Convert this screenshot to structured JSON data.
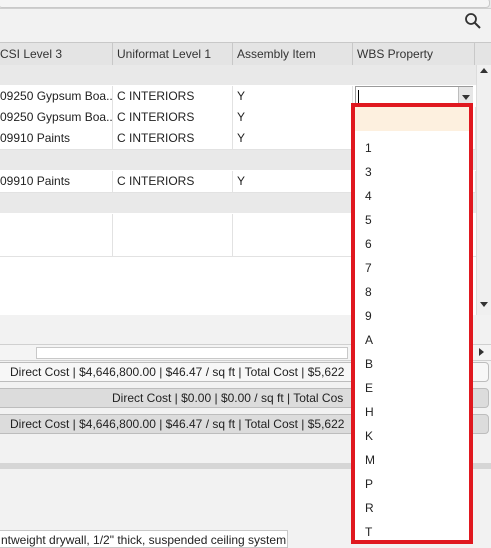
{
  "grid": {
    "columns": [
      "CSI Level 3",
      "Uniformat Level 1",
      "Assembly Item",
      "WBS Property"
    ],
    "rows": [
      {
        "csi": "09250 Gypsum Boa...",
        "uniformat": "C INTERIORS",
        "assembly": "Y",
        "wbs": ""
      },
      {
        "csi": "09250 Gypsum Boa...",
        "uniformat": "C INTERIORS",
        "assembly": "Y",
        "wbs": ""
      },
      {
        "csi": "09910 Paints",
        "uniformat": "C INTERIORS",
        "assembly": "Y",
        "wbs": ""
      },
      {
        "csi": "09910 Paints",
        "uniformat": "C INTERIORS",
        "assembly": "Y",
        "wbs": ""
      }
    ]
  },
  "summary": {
    "row1": "Direct Cost | $4,646,800.00 | $46.47 / sq ft   |   Total Cost | $5,622",
    "row2": "Direct Cost | $0.00 | $0.00 / sq ft   |   Total Cos",
    "row3": "Direct Cost | $4,646,800.00 | $46.47 / sq ft   |   Total Cost | $5,622"
  },
  "description": "ntweight drywall, 1/2\" thick, suspended ceiling system",
  "dropdown": {
    "options": [
      "",
      "1",
      "3",
      "4",
      "5",
      "6",
      "7",
      "8",
      "9",
      "A",
      "B",
      "E",
      "H",
      "K",
      "M",
      "P",
      "R",
      "T"
    ],
    "selected_index": 0
  },
  "icons": {
    "search": "search-icon"
  },
  "colors": {
    "highlight_border": "#e0181f",
    "selected_option": "#fdf0df"
  }
}
